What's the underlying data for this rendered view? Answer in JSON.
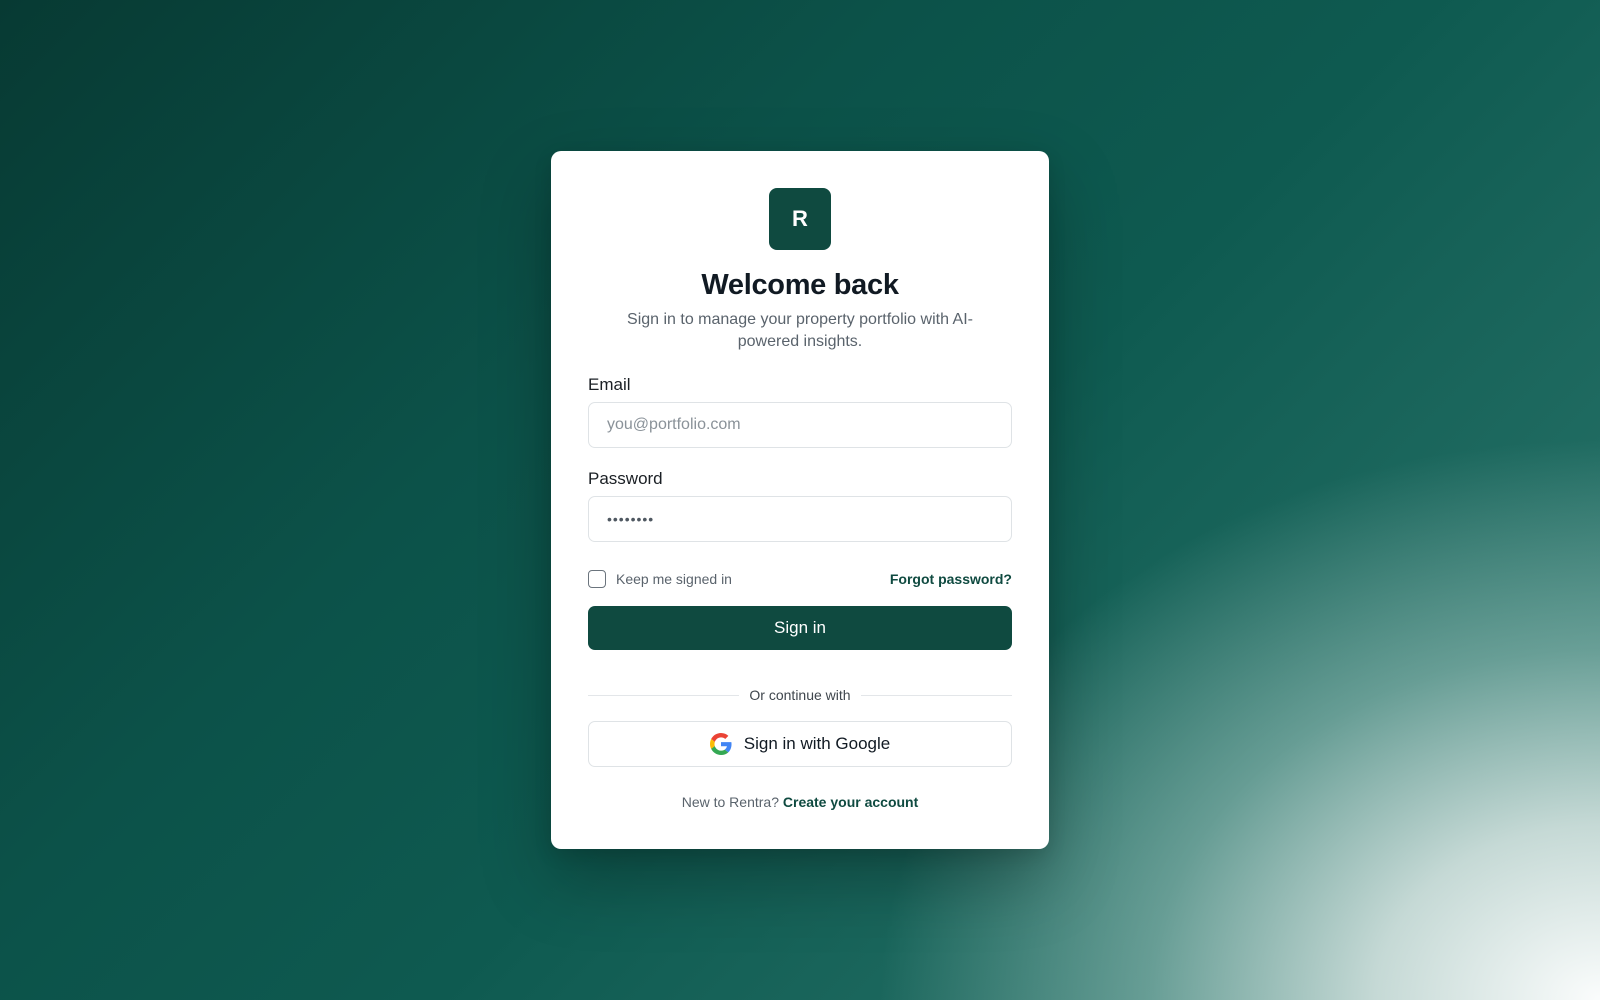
{
  "brand": {
    "logo_letter": "R",
    "accent": "#0f4a40"
  },
  "header": {
    "title": "Welcome back",
    "subtitle": "Sign in to manage your property portfolio with AI-powered insights."
  },
  "form": {
    "email_label": "Email",
    "email_placeholder": "you@portfolio.com",
    "password_label": "Password",
    "password_value": "••••••••",
    "remember_label": "Keep me signed in",
    "remember_checked": false,
    "forgot_label": "Forgot password?",
    "submit_label": "Sign in"
  },
  "divider_text": "Or continue with",
  "google": {
    "label": "Sign in with Google",
    "icon": "google-icon"
  },
  "footer": {
    "prompt": "New to Rentra?",
    "link_label": "Create your account"
  }
}
